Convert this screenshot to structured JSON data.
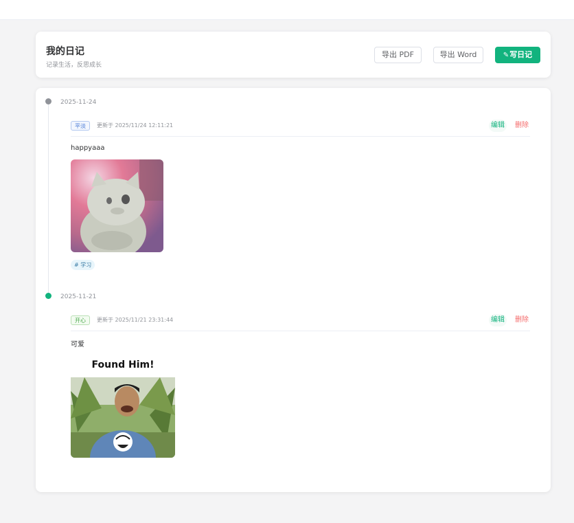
{
  "header": {
    "title": "我的日记",
    "subtitle": "记录生活，反思成长",
    "export_pdf": "导出 PDF",
    "export_word": "导出 Word",
    "write_label": "写日记"
  },
  "entries": [
    {
      "date": "2025-11-24",
      "mood": "平淡",
      "updated": "更新于 2025/11/24 12:11:21",
      "edit": "编辑",
      "delete": "删除",
      "content": "happyaaa",
      "tag": "# 学习"
    },
    {
      "date": "2025-11-21",
      "mood": "开心",
      "updated": "更新于 2025/11/21 23:31:44",
      "edit": "编辑",
      "delete": "删除",
      "content": "可爱",
      "image_caption": "Found Him!"
    }
  ],
  "colors": {
    "accent": "#12b37e",
    "danger": "#f56c6c"
  }
}
